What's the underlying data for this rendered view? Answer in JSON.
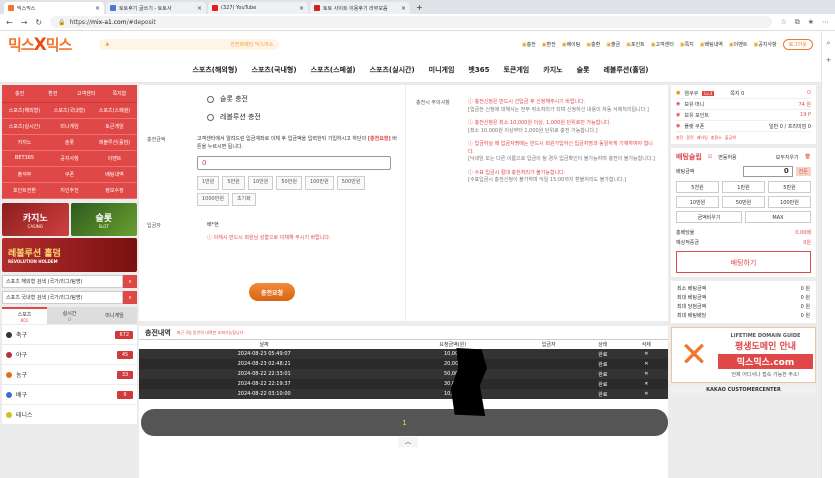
{
  "browser": {
    "tabs": [
      {
        "title": "믹스믹스",
        "color": "#f2762e",
        "active": true
      },
      {
        "title": "토토후기 글쓰기 - 토토사",
        "color": "#4a7bd0",
        "active": false
      },
      {
        "title": "(327) YouTube",
        "color": "#e02020",
        "active": false
      },
      {
        "title": "토토 사이트 이용후기 라부모음",
        "color": "#d02020",
        "active": false
      }
    ],
    "new_tab": "+",
    "url_scheme": "https://",
    "url_host": "mix-a1.com",
    "url_path": "/#deposit"
  },
  "header": {
    "logo_left": "믹스",
    "logo_x": "X",
    "logo_right": "믹스",
    "notice_text": "안전화폐당 믹스여소",
    "links": [
      "충전",
      "환전",
      "베이팅",
      "충환",
      "출금",
      "포인트",
      "고객센터",
      "쪽지",
      "배팅내역",
      "이벤트",
      "공지사항"
    ],
    "logout": "로그아웃"
  },
  "mainnav": [
    "스포츠(해외형)",
    "스포츠(국내형)",
    "스포츠(스페셜)",
    "스포츠(실시간)",
    "미니게임",
    "벳365",
    "토큰게임",
    "카지노",
    "슬롯",
    "레볼루션(홀덤)"
  ],
  "left": {
    "top_cats": [
      "충전",
      "환전",
      "고객센터",
      "쪽지함"
    ],
    "cats": [
      "스포츠(해외형)",
      "스포츠(국내형)",
      "스포츠(스페셜)",
      "스포츠(실시간)",
      "미니게임",
      "토큰게임",
      "카지노",
      "슬롯",
      "레볼루션(홀덤)",
      "BET365",
      "공지사항",
      "이벤트",
      "출석부",
      "쿠폰",
      "베팅내역",
      "포인트전환",
      "지인추천",
      "정보수정"
    ],
    "banner_casino": "카지노",
    "banner_casino_sub": "CASINO",
    "banner_slot": "슬롯",
    "banner_slot_sub": "SLOT",
    "banner_holdem": "레볼루션 홀덤",
    "banner_holdem_sub": "REVOLUTION HOLDEM",
    "search1": "스포츠 해외형 검색 (국가/리그/팀명)",
    "search2": "스포츠 국내형 검색 (국가/리그/팀명)",
    "league_tabs": [
      {
        "label": "스포츠",
        "sub": "801"
      },
      {
        "label": "실시간",
        "sub": "0"
      },
      {
        "label": "미니게임",
        "sub": ""
      }
    ],
    "sports": [
      {
        "name": "축구",
        "count": "672",
        "color": "#333"
      },
      {
        "name": "야구",
        "count": "45",
        "color": "#b33"
      },
      {
        "name": "농구",
        "count": "33",
        "color": "#e07020"
      },
      {
        "name": "배구",
        "count": "9",
        "color": "#3a6fd0"
      },
      {
        "name": "테니스",
        "count": "",
        "color": "#d0c020"
      }
    ]
  },
  "deposit": {
    "option1": "슬롯 충전",
    "option2": "레볼루션 충전",
    "amount_label": "충전금액",
    "desc1": "고객센터에서 알려드린 입금계좌로 이체 후 입금액을 입력한뒤 기입하시고 하단의",
    "desc_hl": "[충전요청]",
    "desc2": "버튼을 누르시면 됩니다.",
    "amount_value": "0",
    "chips": [
      "1만원",
      "5만원",
      "10만원",
      "50만원",
      "100만원",
      "500만원",
      "1000만원",
      "초기화"
    ],
    "depositor_label": "입금자",
    "depositor_value": "배*현",
    "depositor_warn": "ⓘ 이체시 반드시 회원님 성함으로 이체해 주시기 바랍니다.",
    "submit": "충전요청"
  },
  "notes": {
    "title": "충전시 주의사항",
    "items": [
      {
        "red": "ⓘ 충전신청은 반드시 선입금 후 신청해주시기 바랍니다.",
        "gray": "[입금전 신청에 대해서는 전부 취소처리가 되며 신청하신 내용이 자동 삭제처리됩니다.]"
      },
      {
        "red": "ⓘ 충전신청은 최소 10,000원 이상, 1,000원 단위로만 가능합니다.",
        "gray": "[최소 10,000원 이상부터 1,000원 단위로 충전 가능합니다.]"
      },
      {
        "red": "ⓘ 입금하실 때 입금자명에는 반드시 회원가입하신 입금자명과 동일하게 기재하여야 합니다.",
        "gray": "[닉네임 또는 다른 이름으로 입금이 될 경우 입금확인이 불가능하며 충전이 불가능합니다.]"
      },
      {
        "red": "ⓘ 수표 입금시 절대 충전처리가 불가능합니다.",
        "gray": "[수표입금시 충전신청이 불가하며 익일 15:00까지 환불처리도 불가합니다.]"
      }
    ]
  },
  "history": {
    "title": "충전내역",
    "subtitle": "최근 3일 동안의 내역만 조회가능합니다",
    "columns": [
      "날짜",
      "요청금액(원)",
      "입금자",
      "상태",
      "삭제"
    ],
    "rows": [
      [
        "2024-08-23 05:49:07",
        "10,000",
        "",
        "완료",
        "✕"
      ],
      [
        "2024-08-23 02:48:21",
        "20,000",
        "",
        "완료",
        "✕"
      ],
      [
        "2024-08-22 22:33:01",
        "50,000",
        "",
        "완료",
        "✕"
      ],
      [
        "2024-08-22 22:19:37",
        "30,000",
        "",
        "완료",
        "✕"
      ],
      [
        "2024-08-22 03:10:00",
        "10,000",
        "",
        "완료",
        "✕"
      ]
    ],
    "page": "1"
  },
  "account": {
    "user": "염쿠쿠",
    "level": "Lv.3",
    "msg": "쪽지 0",
    "money_label": "보유 머니",
    "money": "74 원",
    "point_label": "보유 포인트",
    "point": "19 P",
    "coupon_label": "플랫 쿠폰",
    "coupon": "일반 0 / 프리미엄 0",
    "icons": [
      "충전",
      "환전",
      "베이팅",
      "충환소",
      "출금액"
    ]
  },
  "slip": {
    "title": "배팅슬립",
    "auto": "변동허용",
    "clear": "모두지우기",
    "amount_label": "배팅금액",
    "amount": "0",
    "erase": "잔돈",
    "buttons": [
      "5천원",
      "1만원",
      "5만원",
      "10만원",
      "50만원",
      "100만원"
    ],
    "reset": "금액비우기",
    "max": "MAX",
    "odds_label": "총배당율",
    "odds": "0.00배",
    "expected_label": "예상적중금",
    "expected": "0원",
    "bet": "배팅하기"
  },
  "limits": [
    {
      "label": "최소 베팅금액",
      "value": "0 원"
    },
    {
      "label": "최대 베팅금액",
      "value": "0 원"
    },
    {
      "label": "최대 당첨금액",
      "value": "0 원"
    },
    {
      "label": "최대 배팅배당",
      "value": "0 원"
    }
  ],
  "ad": {
    "line1": "LIFETIME DOMAIN GUIDE",
    "line2": "평생도메인 안내",
    "line3": "믹스믹스.com",
    "line4": "언제 어디서나 접속 가능한 주소!",
    "kakao": "KAKAO CUSTOMERCENTER"
  }
}
